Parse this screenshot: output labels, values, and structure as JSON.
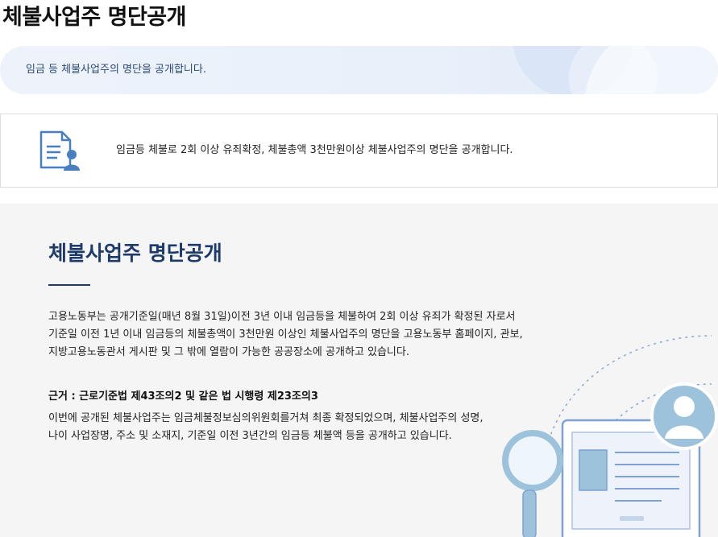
{
  "page_title": "체불사업주 명단공개",
  "banner": {
    "text": "임금 등 체불사업주의 명단을 공개합니다."
  },
  "info_box": {
    "text": "임금등 체불로 2회 이상 유죄확정, 체불총액 3천만원이상 체불사업주의 명단을 공개합니다."
  },
  "section": {
    "title": "체불사업주 명단공개",
    "paragraph_lines": [
      "고용노동부는 공개기준일(매년 8월 31일)이전 3년 이내 임금등을 체불하여 2회 이상 유죄가 확정된 자로서",
      "기준일 이전 1년 이내 임금등의 체불총액이 3천만원 이상인 체불사업주의 명단을 고용노동부 홈페이지, 관보,",
      "지방고용노동관서 게시판 및 그 밖에 열람이 가능한 공공장소에 공개하고 있습니다."
    ],
    "basis_heading": "근거 : 근로기준법 제43조의2 및 같은 법 시행령 제23조의3",
    "basis_lines": [
      "이번에 공개된 체불사업주는 임금체불정보심의위원회를거쳐 최종 확정되었으며, 체불사업주의 성명,",
      "나이 사업장명, 주소 및 소재지, 기준일 이전 3년간의 임금등 체불액 등을 공개하고 있습니다."
    ]
  },
  "colors": {
    "accent": "#1d3a6b",
    "banner_bg": "#eef3fb",
    "section_bg": "#f5f5f5",
    "icon": "#4a7fbf"
  }
}
